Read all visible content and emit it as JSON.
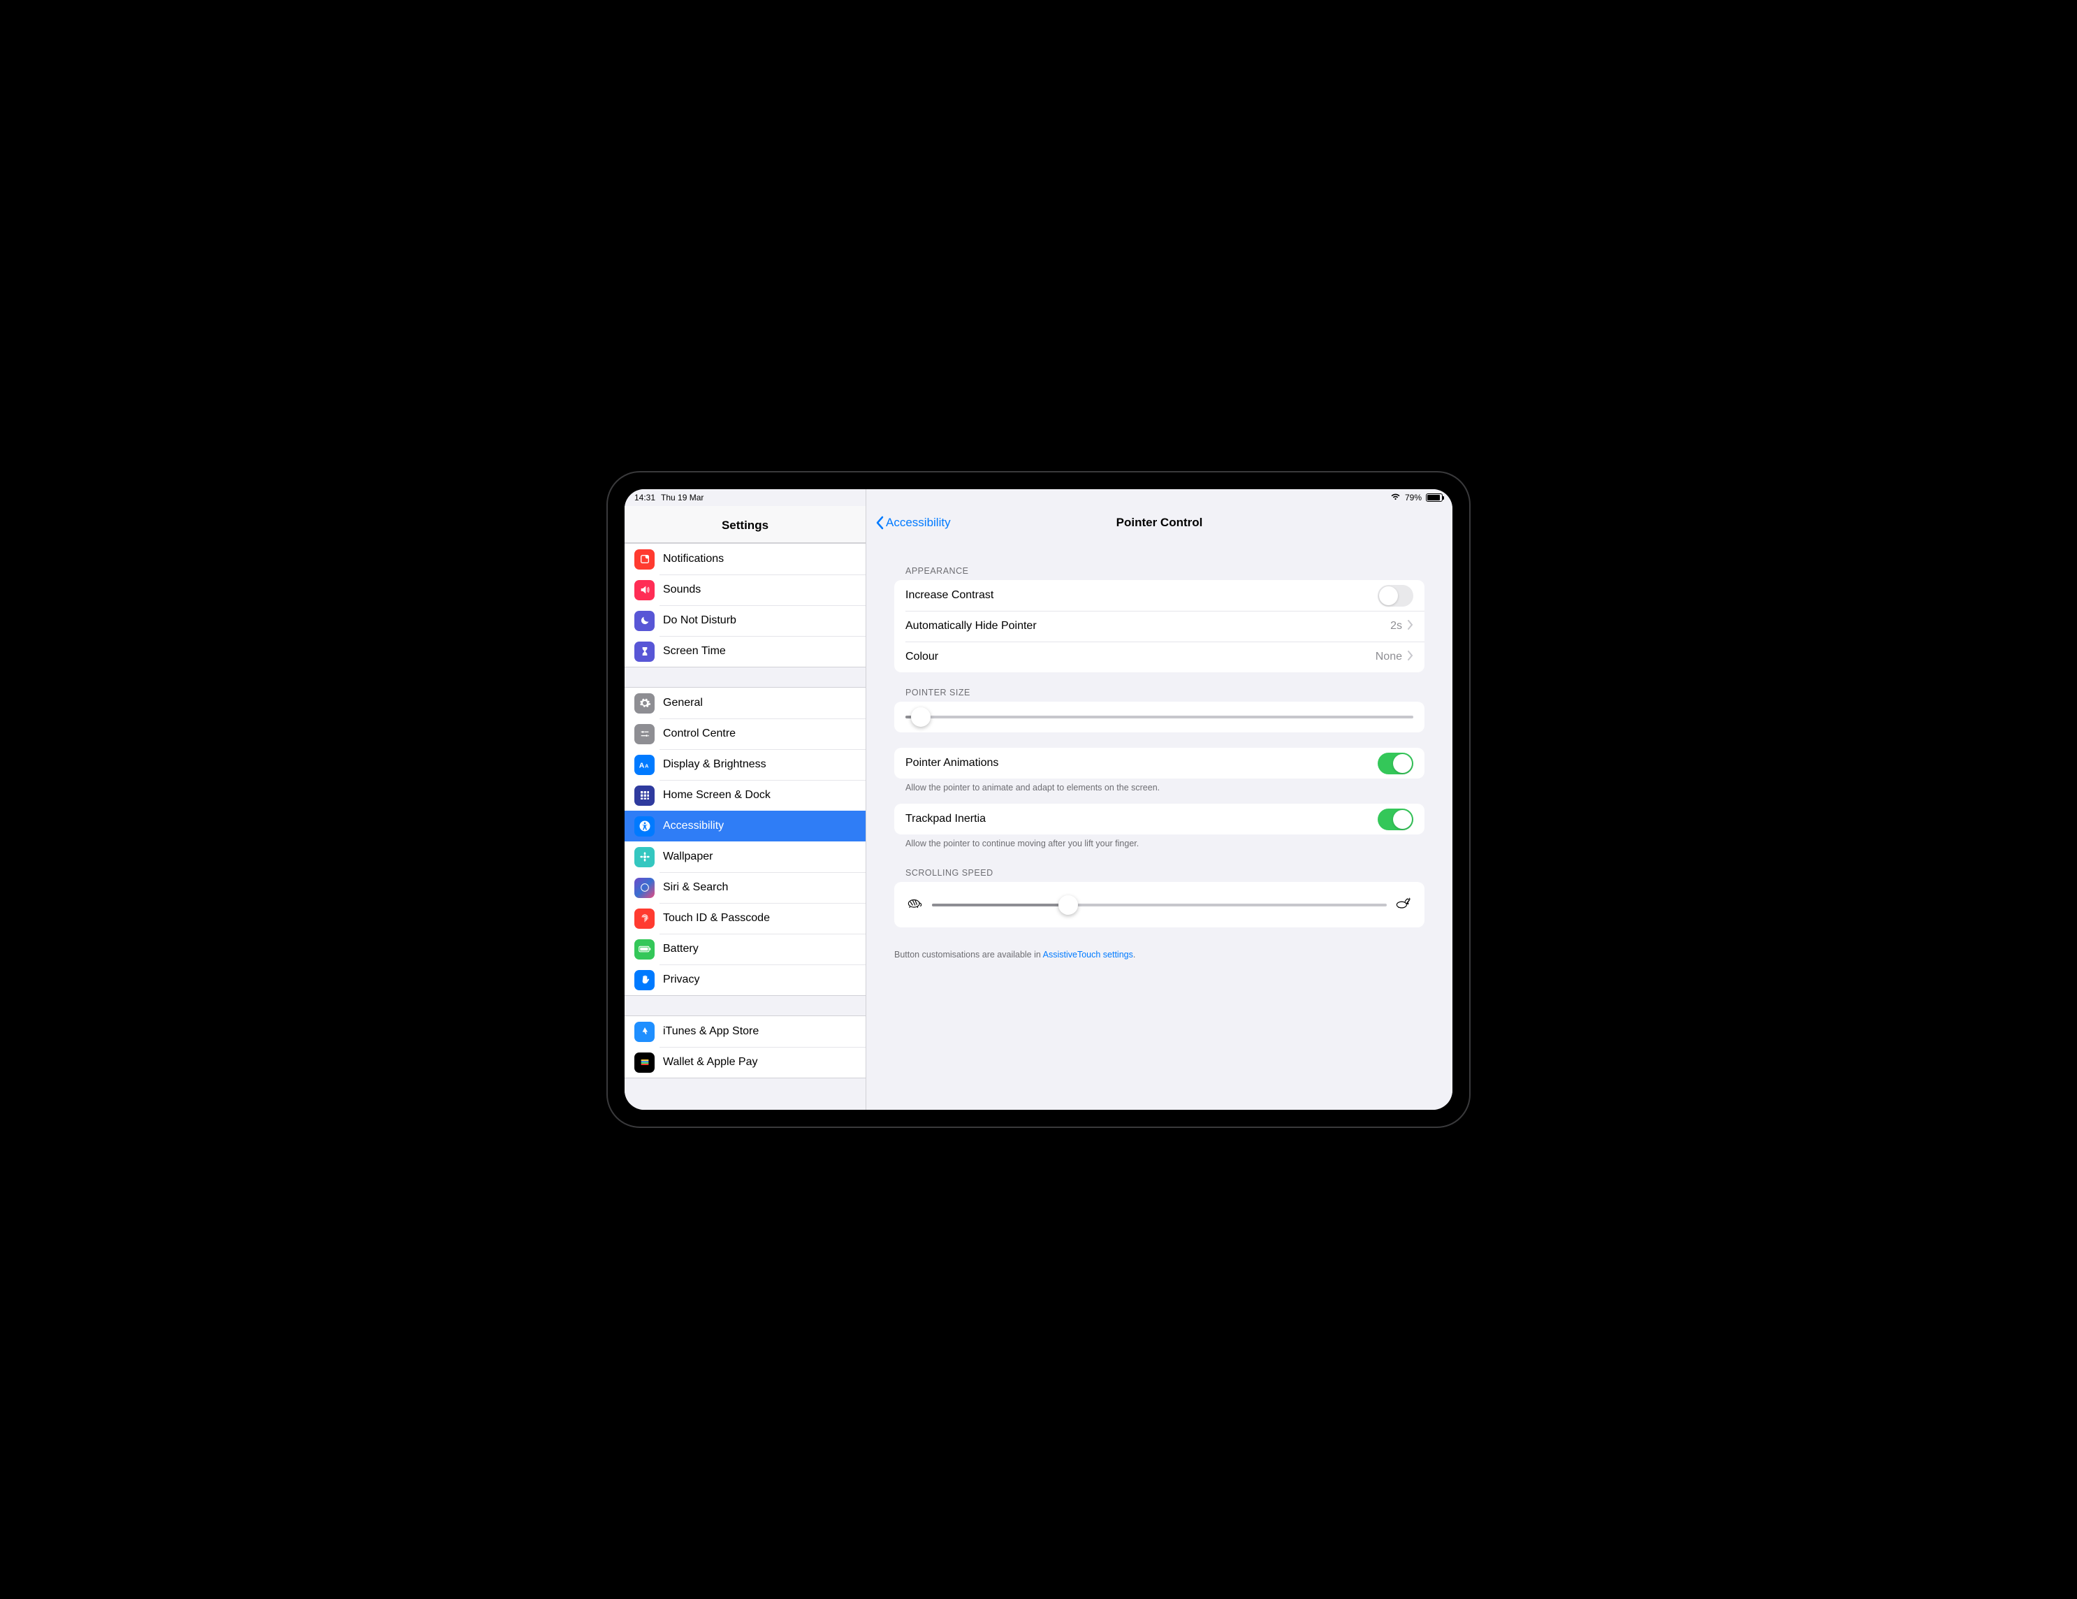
{
  "status": {
    "time": "14:31",
    "date": "Thu 19 Mar",
    "battery_pct": "79%"
  },
  "sidebar": {
    "title": "Settings",
    "group1": [
      {
        "label": "Notifications",
        "icon": "notif"
      },
      {
        "label": "Sounds",
        "icon": "sounds"
      },
      {
        "label": "Do Not Disturb",
        "icon": "dnd"
      },
      {
        "label": "Screen Time",
        "icon": "screentime"
      }
    ],
    "group2": [
      {
        "label": "General",
        "icon": "general"
      },
      {
        "label": "Control Centre",
        "icon": "control"
      },
      {
        "label": "Display & Brightness",
        "icon": "display"
      },
      {
        "label": "Home Screen & Dock",
        "icon": "home"
      },
      {
        "label": "Accessibility",
        "icon": "access",
        "selected": true
      },
      {
        "label": "Wallpaper",
        "icon": "wallpaper"
      },
      {
        "label": "Siri & Search",
        "icon": "siri"
      },
      {
        "label": "Touch ID & Passcode",
        "icon": "touchid"
      },
      {
        "label": "Battery",
        "icon": "battery"
      },
      {
        "label": "Privacy",
        "icon": "privacy"
      }
    ],
    "group3": [
      {
        "label": "iTunes & App Store",
        "icon": "itunes"
      },
      {
        "label": "Wallet & Apple Pay",
        "icon": "wallet"
      }
    ]
  },
  "detail": {
    "back_label": "Accessibility",
    "title": "Pointer Control",
    "appearance_header": "APPEARANCE",
    "increase_contrast": "Increase Contrast",
    "increase_contrast_on": false,
    "auto_hide": "Automatically Hide Pointer",
    "auto_hide_value": "2s",
    "colour_label": "Colour",
    "colour_value": "None",
    "pointer_size_header": "POINTER SIZE",
    "pointer_size_pct": 3,
    "pointer_animations": "Pointer Animations",
    "pointer_animations_on": true,
    "pointer_animations_note": "Allow the pointer to animate and adapt to elements on the screen.",
    "trackpad_inertia": "Trackpad Inertia",
    "trackpad_inertia_on": true,
    "trackpad_inertia_note": "Allow the pointer to continue moving after you lift your finger.",
    "scrolling_speed_header": "SCROLLING SPEED",
    "scrolling_speed_pct": 30,
    "button_note_prefix": "Button customisations are available in ",
    "button_note_link": "AssistiveTouch settings",
    "button_note_suffix": "."
  }
}
